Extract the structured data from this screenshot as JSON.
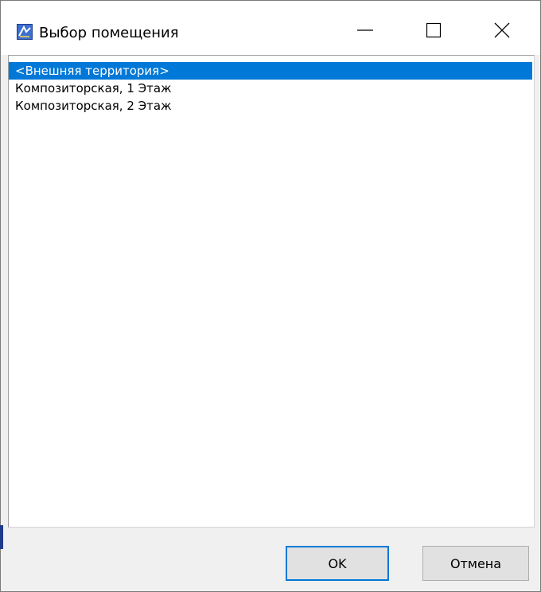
{
  "window": {
    "title": "Выбор помещения",
    "accent_color": "#0078d7"
  },
  "icons": {
    "app": "app-icon",
    "minimize": "minimize-icon",
    "maximize": "maximize-icon",
    "close": "close-icon"
  },
  "list": {
    "items": [
      {
        "label": "<Внешняя территория>",
        "selected": true
      },
      {
        "label": "Композиторская, 1 Этаж",
        "selected": false
      },
      {
        "label": "Композиторская, 2 Этаж",
        "selected": false
      }
    ]
  },
  "buttons": {
    "ok_label": "OK",
    "cancel_label": "Отмена"
  }
}
